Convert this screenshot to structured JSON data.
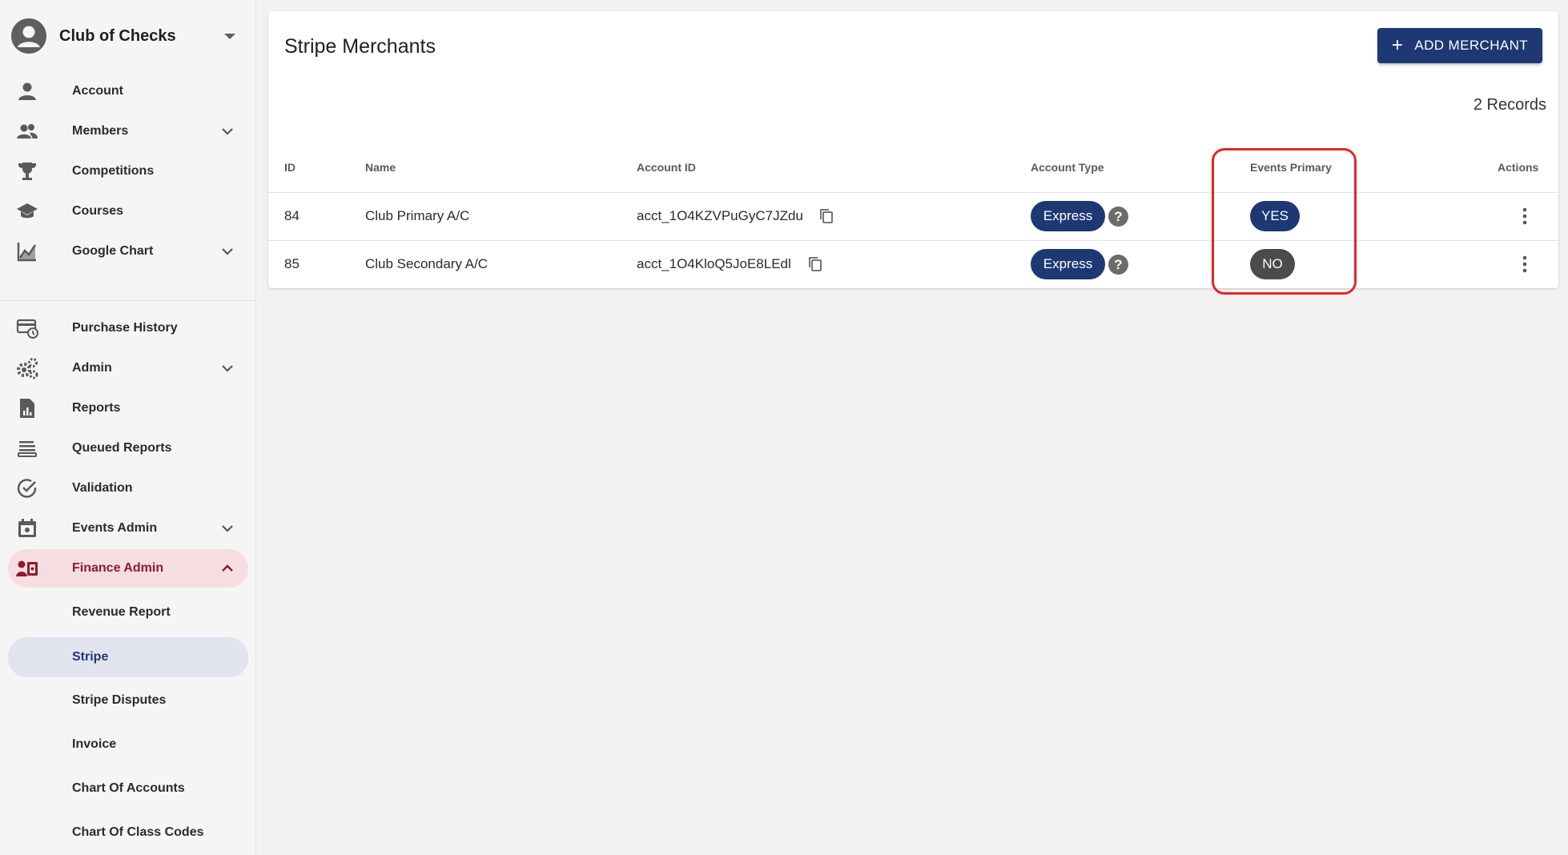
{
  "sidebar": {
    "club_name": "Club of Checks",
    "items": [
      {
        "label": "Account"
      },
      {
        "label": "Members"
      },
      {
        "label": "Competitions"
      },
      {
        "label": "Courses"
      },
      {
        "label": "Google Chart"
      },
      {
        "label": "Purchase History"
      },
      {
        "label": "Admin"
      },
      {
        "label": "Reports"
      },
      {
        "label": "Queued Reports"
      },
      {
        "label": "Validation"
      },
      {
        "label": "Events Admin"
      },
      {
        "label": "Finance Admin"
      },
      {
        "label": "Revenue Report"
      },
      {
        "label": "Stripe"
      },
      {
        "label": "Stripe Disputes"
      },
      {
        "label": "Invoice"
      },
      {
        "label": "Chart Of Accounts"
      },
      {
        "label": "Chart Of Class Codes"
      }
    ]
  },
  "main": {
    "title": "Stripe Merchants",
    "add_button": "ADD MERCHANT",
    "records": "2 Records",
    "columns": [
      "ID",
      "Name",
      "Account ID",
      "Account Type",
      "Events Primary",
      "Actions"
    ],
    "rows": [
      {
        "id": "84",
        "name": "Club Primary A/C",
        "account_id": "acct_1O4KZVPuGyC7JZdu",
        "account_type": "Express",
        "events_primary": "YES"
      },
      {
        "id": "85",
        "name": "Club Secondary A/C",
        "account_id": "acct_1O4KloQ5JoE8LEdl",
        "account_type": "Express",
        "events_primary": "NO"
      }
    ],
    "help_glyph": "?"
  },
  "colors": {
    "primary": "#1d3873",
    "finance_accent": "#8c1b2c",
    "highlight": "#e5252a",
    "no_chip": "#4b4b4b"
  }
}
